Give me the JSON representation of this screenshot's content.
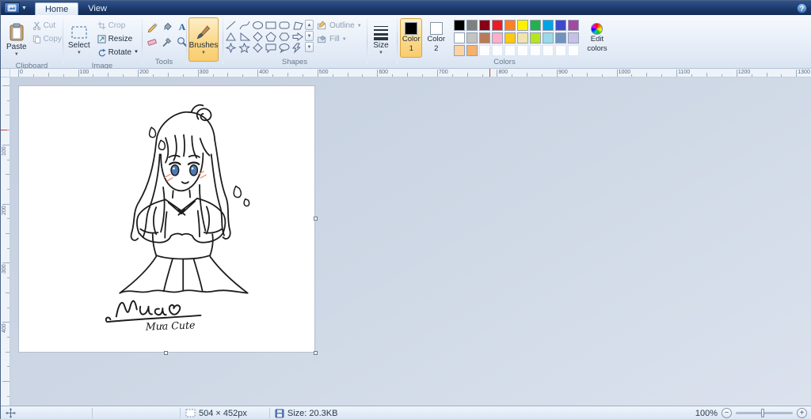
{
  "tabs": [
    {
      "label": "Home"
    },
    {
      "label": "View"
    }
  ],
  "ribbon": {
    "clipboard": {
      "label": "Clipboard",
      "paste": "Paste",
      "cut": "Cut",
      "copy": "Copy"
    },
    "image": {
      "label": "Image",
      "select": "Select",
      "crop": "Crop",
      "resize": "Resize",
      "rotate": "Rotate"
    },
    "tools": {
      "label": "Tools"
    },
    "brushes": {
      "label": "Brushes"
    },
    "shapes": {
      "label": "Shapes",
      "outline": "Outline",
      "fill": "Fill"
    },
    "size": {
      "label": "Size"
    },
    "colors": {
      "label": "Colors",
      "color1": {
        "line1": "Color",
        "line2": "1",
        "value": "#000000"
      },
      "color2": {
        "line1": "Color",
        "line2": "2",
        "value": "#ffffff"
      },
      "edit": {
        "line1": "Edit",
        "line2": "colors"
      },
      "palette": [
        [
          "#000000",
          "#7f7f7f",
          "#880015",
          "#ed1c24",
          "#ff7f27",
          "#fff200",
          "#22b14c",
          "#00a2e8",
          "#3f48cc",
          "#a349a4"
        ],
        [
          "#ffffff",
          "#c3c3c3",
          "#b97a57",
          "#ffaec9",
          "#ffc90e",
          "#efe4b0",
          "#b5e61d",
          "#99d9ea",
          "#7092be",
          "#c8bfe7"
        ],
        [
          "#fcd3a1",
          "#f5b16d",
          "",
          "",
          "",
          "",
          "",
          "",
          "",
          ""
        ]
      ]
    }
  },
  "ruler": {
    "h_numbers": [
      0,
      100,
      200,
      300,
      400,
      500,
      600,
      700,
      800,
      900,
      1000,
      1100,
      1200,
      1300
    ],
    "v_numbers": [
      100,
      200,
      300,
      400
    ]
  },
  "canvas": {
    "signature": "Mưa Cute"
  },
  "status": {
    "dimensions": "504 × 452px",
    "file_size": "Size: 20.3KB",
    "zoom": "100%"
  },
  "help": {
    "label": "?"
  }
}
